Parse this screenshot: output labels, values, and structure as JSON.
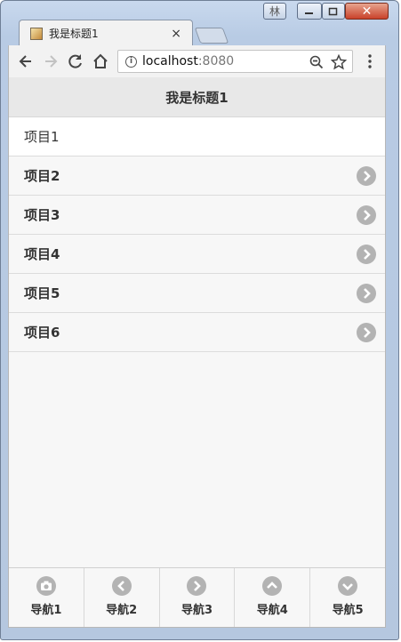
{
  "window": {
    "user_badge": "林",
    "close_glyph": "✕"
  },
  "tab": {
    "title": "我是标题1",
    "close_glyph": "×"
  },
  "address": {
    "host": "localhost",
    "port": ":8080"
  },
  "page": {
    "title": "我是标题1",
    "items": [
      {
        "label": "项目1"
      },
      {
        "label": "项目2"
      },
      {
        "label": "项目3"
      },
      {
        "label": "项目4"
      },
      {
        "label": "项目5"
      },
      {
        "label": "项目6"
      }
    ],
    "nav": [
      {
        "label": "导航1",
        "icon": "camera-icon"
      },
      {
        "label": "导航2",
        "icon": "chevron-left-circle-icon"
      },
      {
        "label": "导航3",
        "icon": "chevron-right-circle-icon"
      },
      {
        "label": "导航4",
        "icon": "chevron-up-circle-icon"
      },
      {
        "label": "导航5",
        "icon": "chevron-down-circle-icon"
      }
    ]
  },
  "colors": {
    "icon_gray": "#b3b3b3",
    "header_bg": "#e8e8e8",
    "page_bg": "#f7f7f7"
  }
}
